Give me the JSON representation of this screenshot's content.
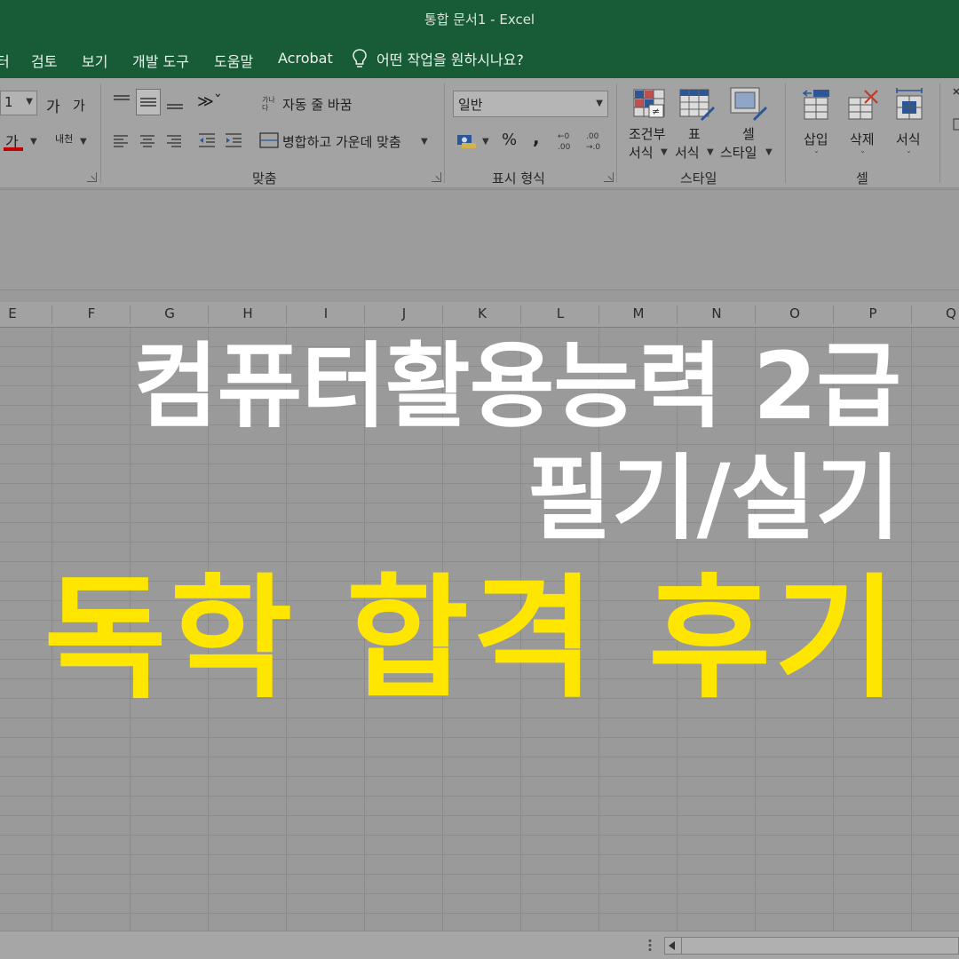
{
  "window": {
    "title": "통합 문서1  -  Excel"
  },
  "menu": {
    "items": [
      "터",
      "검토",
      "보기",
      "개발 도구",
      "도움말",
      "Acrobat"
    ],
    "tell_me": "어떤 작업을 원하시나요?"
  },
  "ribbon": {
    "font": {
      "size_value": "1",
      "grow_label": "가",
      "shrink_label": "가",
      "color_label": "가",
      "phonetic_label": "내천"
    },
    "alignment": {
      "wrap_text": "자동 줄 바꿈",
      "merge_center": "병합하고 가운데 맞춤",
      "group_label": "맞춤"
    },
    "number": {
      "format_value": "일반",
      "percent": "%",
      "comma": ",",
      "group_label": "표시 형식"
    },
    "styles": {
      "conditional_line1": "조건부",
      "conditional_line2": "서식",
      "table_line1": "표",
      "table_line2": "서식",
      "cell_line1": "셀",
      "cell_line2": "스타일",
      "group_label": "스타일"
    },
    "cells": {
      "insert": "삽입",
      "delete": "삭제",
      "format": "서식",
      "group_label": "셀"
    }
  },
  "columns": [
    "E",
    "F",
    "G",
    "H",
    "I",
    "J",
    "K",
    "L",
    "M",
    "N",
    "O",
    "P",
    "Q"
  ],
  "headline": {
    "line1": "컴퓨터활용능력 2급",
    "line2": "필기/실기",
    "line3": "독학 합격 후기",
    "line1_color": "#ffffff",
    "line3_color": "#ffe600"
  },
  "colors": {
    "titlebar": "#185c37",
    "dimmed_ui": "#9a9a9a"
  }
}
